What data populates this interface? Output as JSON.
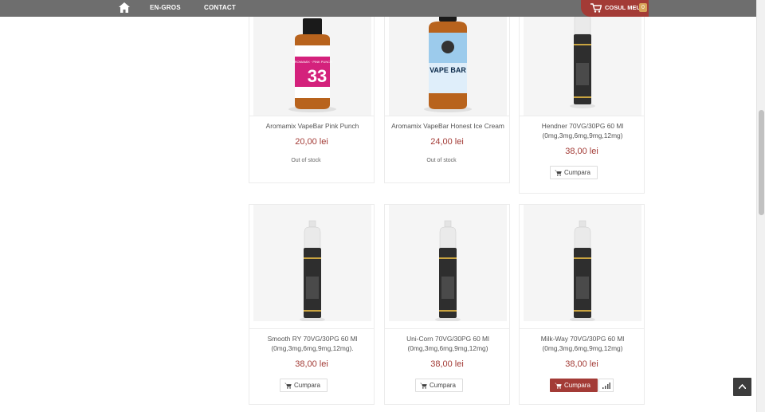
{
  "nav": {
    "home_icon": "home-icon",
    "links": [
      "EN-GROS",
      "CONTACT"
    ],
    "cart": {
      "label": "COSUL MEU",
      "count": "0",
      "icon": "cart-icon",
      "color": "#a33b36"
    }
  },
  "colors": {
    "accent": "#a33b36",
    "topbar": "#6e6e6e"
  },
  "products": [
    {
      "name": "Aromamix VapeBar Pink Punch",
      "price": "20,00 lei",
      "status": "Out of stock"
    },
    {
      "name": "Aromamix VapeBar Honest Ice Cream",
      "price": "24,00 lei",
      "status": "Out of stock"
    },
    {
      "name": "Hendner 70VG/30PG 60 Ml (0mg,3mg,6mg,9mg,12mg)",
      "price": "38,00 lei",
      "button": "Cumpara"
    },
    {
      "name": "Smooth RY 70VG/30PG 60 Ml (0mg,3mg,6mg,9mg,12mg).",
      "price": "38,00 lei",
      "button": "Cumpara"
    },
    {
      "name": "Uni-Corn 70VG/30PG 60 Ml (0mg,3mg,6mg,9mg,12mg)",
      "price": "38,00 lei",
      "button": "Cumpara"
    },
    {
      "name": "Milk-Way 70VG/30PG 60 Ml (0mg,3mg,6mg,9mg,12mg)",
      "price": "38,00 lei",
      "button": "Cumpara"
    }
  ],
  "labels": {
    "pink_bottle_text": "33",
    "pink_bottle_brand": "AROMAMIX · PINK PUNCH",
    "vape_bar_text": "VAPE BAR"
  }
}
